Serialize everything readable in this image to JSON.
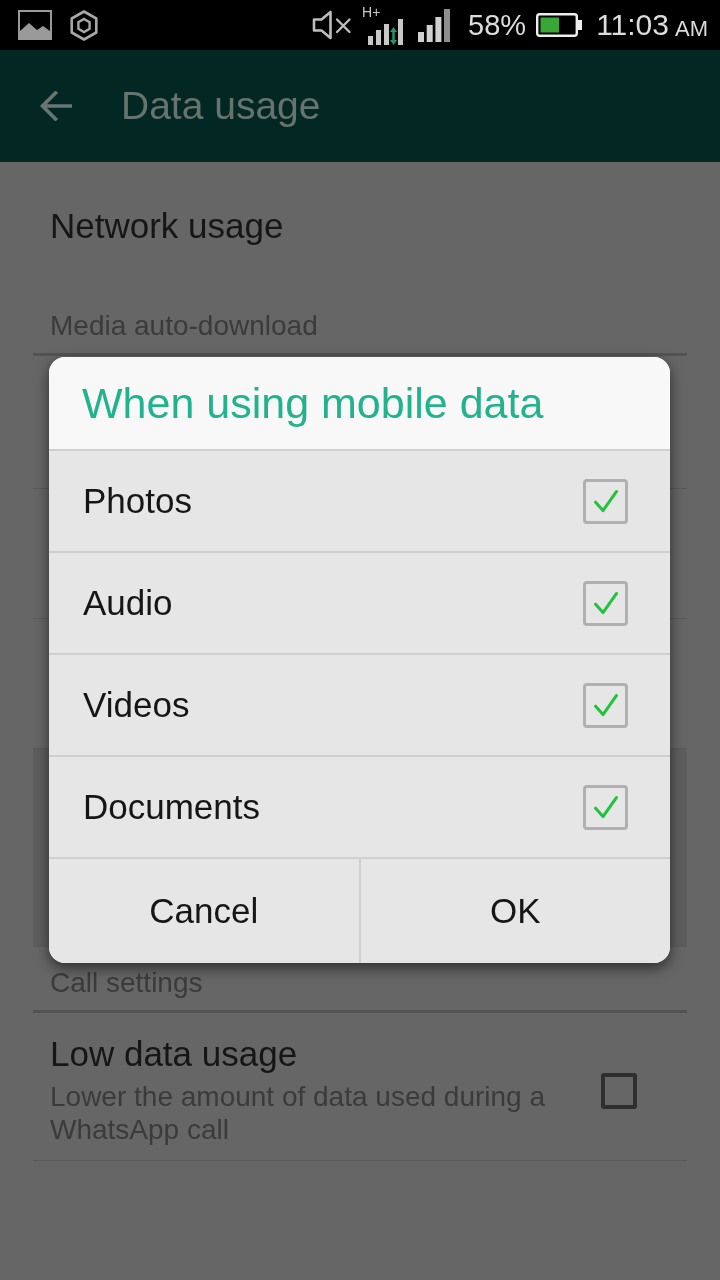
{
  "status_bar": {
    "network_type": "H+",
    "battery_percent": "58%",
    "time": "11:03",
    "time_period": "AM"
  },
  "app_bar": {
    "title": "Data usage"
  },
  "network_usage": {
    "title": "Network usage"
  },
  "media_auto_download": {
    "header": "Media auto-download"
  },
  "call_settings": {
    "header": "Call settings",
    "items": [
      {
        "title": "Low data usage",
        "summary": "Lower the amount of data used during a WhatsApp call",
        "checked": false
      }
    ]
  },
  "dialog": {
    "title": "When using mobile data",
    "options": [
      {
        "label": "Photos",
        "checked": true
      },
      {
        "label": "Audio",
        "checked": true
      },
      {
        "label": "Videos",
        "checked": true
      },
      {
        "label": "Documents",
        "checked": true
      }
    ],
    "buttons": [
      "Cancel",
      "OK"
    ]
  }
}
